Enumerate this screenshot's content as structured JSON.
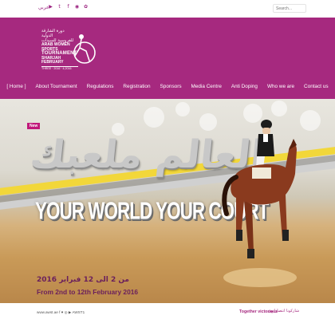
{
  "topbar": {
    "language_link": "عربي",
    "social_icons": [
      "youtube-icon",
      "twitter-icon",
      "facebook-icon",
      "instagram-icon",
      "snapchat-icon"
    ],
    "social_glyphs": [
      "▶",
      "t",
      "f",
      "◉",
      "✿"
    ],
    "search_placeholder": "Search..."
  },
  "logo": {
    "arabic_line1": "دورة الشارقة الدولية",
    "arabic_line2": "للفروسية للسيدات",
    "english_line1": "ARAB WOMEN SPORTS",
    "english_line2": "TOURNAMENT",
    "english_line3": "SHARJAH",
    "english_line4": "FEBRUARY",
    "dates_line": "THREE · 2016 · 4,2016"
  },
  "nav": {
    "items": [
      "[ Home ]",
      "About Tournament",
      "Regulations",
      "Registration",
      "Sponsors",
      "Media Centre",
      "Anti Doping",
      "Who we are",
      "Contact us"
    ]
  },
  "hero": {
    "badge": "New",
    "arabic_headline": "العالم ملعبك",
    "slogan": "YOUR WORLD YOUR COURT",
    "date_arabic": "من 2 الى 12 فبراير 2016",
    "date_english": "From 2nd to 12th February 2016"
  },
  "footer": {
    "url": "www.awst.ae   f ♥ ◎ ▶  AWST1",
    "tagline": "Together victorious",
    "tagline_arabic": "شاركونا انتصاراتهن"
  },
  "colors": {
    "brand_purple": "#a6297f",
    "date_purple": "#6a1f5c",
    "badge": "#c0187a"
  }
}
